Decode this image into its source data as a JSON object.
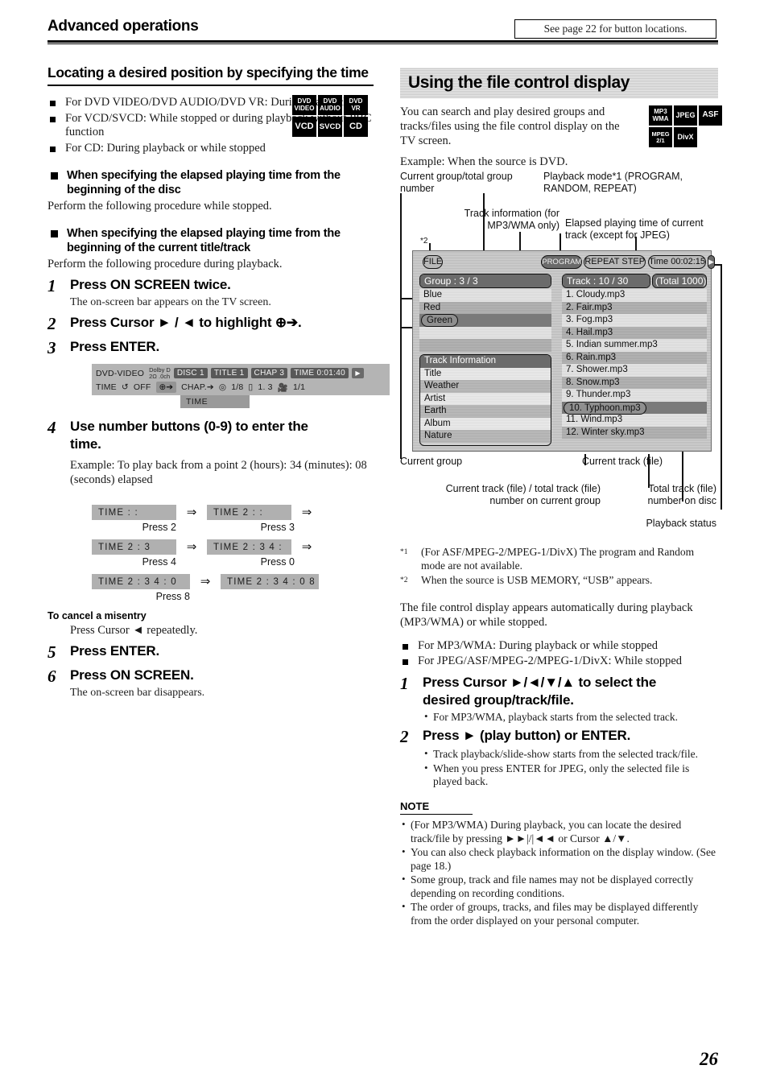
{
  "header": {
    "title": "Advanced operations",
    "note": "See page 22 for button locations."
  },
  "left": {
    "section_title": "Locating a desired position by specifying the time",
    "bullets": [
      "For DVD VIDEO/DVD AUDIO/DVD VR: During playback",
      "For VCD/SVCD: While stopped or during playback without PBC function",
      "For CD: During playback or while stopped"
    ],
    "media_badges": [
      {
        "line1": "DVD",
        "line2": "VIDEO"
      },
      {
        "line1": "DVD",
        "line2": "AUDIO"
      },
      {
        "line1": "DVD",
        "line2": "VR"
      },
      {
        "line1": "VCD",
        "line2": ""
      },
      {
        "line1": "SVCD",
        "line2": ""
      },
      {
        "line1": "CD",
        "line2": ""
      }
    ],
    "sub1_heading": "When specifying the elapsed playing time from the beginning of the disc",
    "sub1_body": "Perform the following procedure while stopped.",
    "sub2_heading": "When specifying the elapsed playing time from the beginning of the current title/track",
    "sub2_body": "Perform the following procedure during playback.",
    "steps": [
      {
        "num": "1",
        "text": "Press ON SCREEN twice.",
        "sub": "The on-screen bar appears on the TV screen."
      },
      {
        "num": "2",
        "text": "Press Cursor ► / ◄ to highlight ⊕➔.",
        "sub": ""
      },
      {
        "num": "3",
        "text": "Press ENTER.",
        "sub": ""
      }
    ],
    "osd_bar": {
      "source": "DVD-VIDEO",
      "dolby_line1": "Dolby D",
      "dolby_line2": "2Ω .0ch",
      "disc": "DISC 1",
      "title": "TITLE  1",
      "chapter": "CHAP  3",
      "time": "TIME   0:01:40",
      "play_icon": "▶",
      "row2_time_label": "TIME",
      "row2_repeat": "OFF",
      "row2_clock": "⊕➔",
      "row2_chap": "CHAP.➔",
      "row2_audio": "1/8",
      "row2_subtitle": "1.  3",
      "row2_angle": "1/1",
      "time_tab": "TIME"
    },
    "step4": {
      "num": "4",
      "text": "Use number buttons (0-9) to enter the time."
    },
    "step4_example": "Example: To play back from a point 2 (hours): 34 (minutes): 08 (seconds) elapsed",
    "time_sequence": [
      {
        "a": "TIME    :    :",
        "a_press": "Press 2",
        "b": "TIME  2 :    :",
        "b_press": "Press 3"
      },
      {
        "a": "TIME  2 : 3",
        "a_press": "Press 4",
        "b": "TIME  2 : 3 4 :",
        "b_press": "Press 0"
      },
      {
        "a": "TIME  2 : 3 4 : 0",
        "a_press": "Press 8",
        "b": "TIME  2 : 3 4 : 0 8",
        "b_press": ""
      }
    ],
    "cancel_heading": "To cancel a misentry",
    "cancel_body": "Press Cursor ◄ repeatedly.",
    "steps_end": [
      {
        "num": "5",
        "text": "Press ENTER.",
        "sub": ""
      },
      {
        "num": "6",
        "text": "Press ON SCREEN.",
        "sub": "The on-screen bar disappears."
      }
    ]
  },
  "right": {
    "section_title": "Using the file control display",
    "intro": "You can search and play desired groups and tracks/files using the file control display on the TV screen.",
    "example_line": "Example: When the source is DVD.",
    "media_badges": [
      {
        "line1": "MP3",
        "line2": "WMA"
      },
      {
        "line1": "JPEG",
        "line2": ""
      },
      {
        "line1": "ASF",
        "line2": ""
      },
      {
        "line1": "MPEG",
        "line2": "2/1"
      },
      {
        "line1": "DivX",
        "line2": ""
      }
    ],
    "callouts": {
      "current_group_total": "Current group/total group number",
      "playback_mode": "Playback mode*1 (PROGRAM, RANDOM, REPEAT)",
      "track_information": "Track information (for MP3/WMA only)",
      "elapsed_time": "Elapsed playing time of current track (except for JPEG)",
      "star2": "*2",
      "current_group": "Current group",
      "current_track_file": "Current track (file)",
      "current_total_group": "Current track (file) / total track (file) number on current group",
      "total_track_disc": "Total track (file) number on disc",
      "playback_status": "Playback status"
    },
    "fcd": {
      "file_chip": "FILE",
      "program_chip": "PROGRAM",
      "repeat_chip": "REPEAT STEP",
      "time_chip": "Time 00:02:15",
      "play_chip": "▶",
      "group_header": "Group :   3 / 3",
      "groups": [
        "Blue",
        "Red",
        "Green"
      ],
      "group_selected": "Green",
      "track_info_header": "Track  Information",
      "track_info_rows": [
        "Title",
        "Weather",
        "Artist",
        "Earth",
        "Album",
        "Nature"
      ],
      "track_header": "Track :  10 / 30",
      "total_header": "(Total  1000)",
      "tracks": [
        "1. Cloudy.mp3",
        "2. Fair.mp3",
        "3. Fog.mp3",
        "4. Hail.mp3",
        "5. Indian summer.mp3",
        "6. Rain.mp3",
        "7. Shower.mp3",
        "8. Snow.mp3",
        "9. Thunder.mp3",
        "10. Typhoon.mp3",
        "11. Wind.mp3",
        "12. Winter sky.mp3"
      ],
      "track_selected": "10. Typhoon.mp3"
    },
    "footnotes": [
      {
        "marker": "*1",
        "text": "(For ASF/MPEG-2/MPEG-1/DivX) The program and Random mode are not available."
      },
      {
        "marker": "*2",
        "text": "When the source is USB MEMORY, “USB” appears."
      }
    ],
    "auto_text": "The file control display appears automatically during playback (MP3/WMA) or while stopped.",
    "bullets": [
      "For MP3/WMA: During playback or while stopped",
      "For JPEG/ASF/MPEG-2/MPEG-1/DivX: While stopped"
    ],
    "steps": [
      {
        "num": "1",
        "text": "Press Cursor ►/◄/▼/▲ to select the desired group/track/file.",
        "subs": [
          "For MP3/WMA, playback starts from the selected track."
        ]
      },
      {
        "num": "2",
        "text": "Press ► (play button) or ENTER.",
        "subs": [
          "Track playback/slide-show starts from the selected track/file.",
          "When you press ENTER for JPEG, only the selected file is played back."
        ]
      }
    ],
    "note_heading": "NOTE",
    "notes": [
      "(For MP3/WMA) During playback, you can locate the desired track/file by pressing ►►|/|◄◄ or Cursor ▲/▼.",
      "You can also check playback information on the display window. (See page 18.)",
      "Some group, track and file names may not be displayed correctly depending on recording conditions.",
      "The order of groups, tracks, and files may be displayed differently from the order displayed on your personal computer."
    ]
  },
  "page_number": "26"
}
